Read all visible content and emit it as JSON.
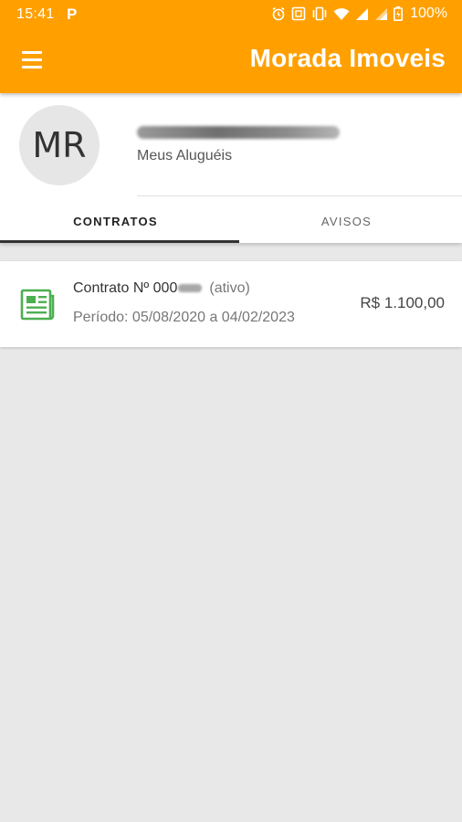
{
  "status_bar": {
    "time": "15:41",
    "notification_icon": "P",
    "icons": [
      "alarm-icon",
      "nfc-icon",
      "vibrate-icon",
      "wifi-icon",
      "signal-icon",
      "signal-icon",
      "battery-icon"
    ],
    "battery": "100%"
  },
  "app_bar": {
    "menu_icon": "hamburger-menu-icon",
    "title": "Morada Imoveis",
    "color": "#ffa000"
  },
  "profile": {
    "initials": "MR",
    "subtitle": "Meus Aluguéis"
  },
  "tabs": [
    {
      "label": "CONTRATOS",
      "active": true
    },
    {
      "label": "AVISOS",
      "active": false
    }
  ],
  "contracts": [
    {
      "icon": "document-icon",
      "icon_color": "#4caf50",
      "title_prefix": "Contrato Nº 000",
      "status": "(ativo)",
      "period": "Período: 05/08/2020 a 04/02/2023",
      "value": "R$ 1.100,00"
    }
  ]
}
